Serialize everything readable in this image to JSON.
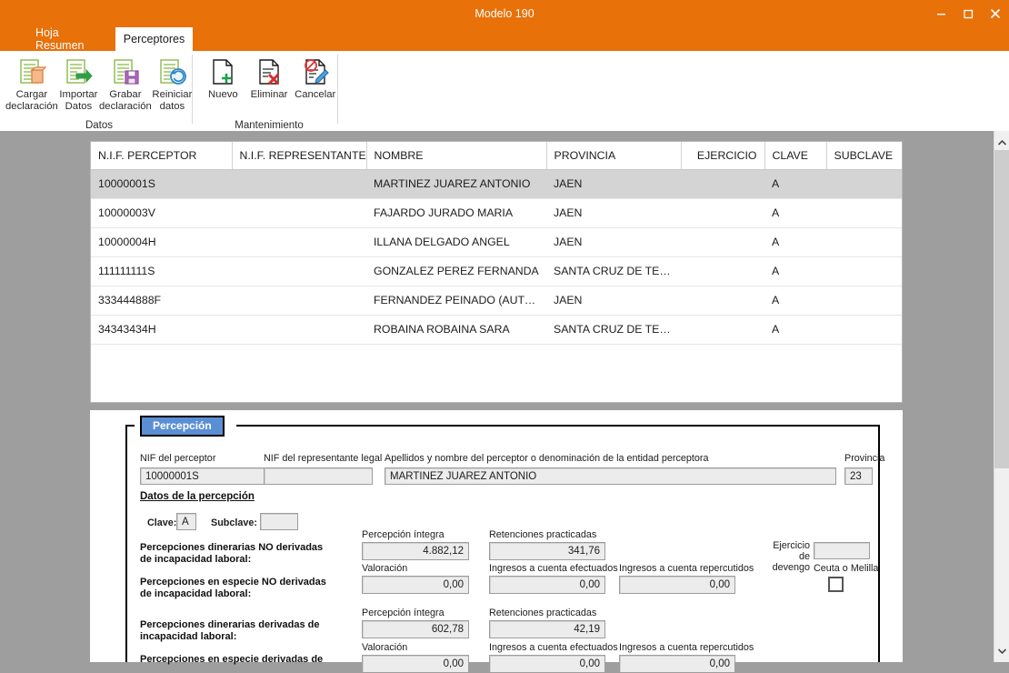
{
  "window": {
    "title": "Modelo 190",
    "accent_color": "#e8710a",
    "controls": [
      {
        "name": "minimize",
        "glyph": "—"
      },
      {
        "name": "maximize",
        "glyph": "☐"
      },
      {
        "name": "close",
        "glyph": "✕"
      }
    ]
  },
  "tabs": [
    {
      "id": "hoja-resumen",
      "label": "Hoja Resumen",
      "active": false
    },
    {
      "id": "perceptores",
      "label": "Perceptores",
      "active": true
    }
  ],
  "ribbon": {
    "groups": [
      {
        "id": "datos",
        "label": "Datos",
        "buttons": [
          {
            "id": "cargar-declaracion",
            "label": "Cargar\ndeclaración",
            "icon": "document-load-icon"
          },
          {
            "id": "importar-datos",
            "label": "Importar\nDatos",
            "icon": "document-import-arrow-icon"
          },
          {
            "id": "grabar-declaracion",
            "label": "Grabar\ndeclaración",
            "icon": "document-save-floppy-icon"
          },
          {
            "id": "reiniciar-datos",
            "label": "Reiniciar\ndatos",
            "icon": "document-refresh-icon"
          }
        ]
      },
      {
        "id": "mantenimiento",
        "label": "Mantenimiento",
        "buttons": [
          {
            "id": "nuevo",
            "label": "Nuevo",
            "icon": "document-plus-icon"
          },
          {
            "id": "eliminar",
            "label": "Eliminar",
            "icon": "document-delete-x-icon"
          },
          {
            "id": "cancelar",
            "label": "Cancelar",
            "icon": "document-cancel-pencil-icon"
          }
        ]
      }
    ]
  },
  "grid": {
    "columns": [
      {
        "key": "nif",
        "label": "N.I.F. PERCEPTOR",
        "align": "left"
      },
      {
        "key": "representante",
        "label": "N.I.F. REPRESENTANTE",
        "align": "left"
      },
      {
        "key": "nombre",
        "label": "NOMBRE",
        "align": "left"
      },
      {
        "key": "provincia",
        "label": "PROVINCIA",
        "align": "left"
      },
      {
        "key": "ejercicio",
        "label": "EJERCICIO",
        "align": "right"
      },
      {
        "key": "clave",
        "label": "CLAVE",
        "align": "left"
      },
      {
        "key": "subclave",
        "label": "SUBCLAVE",
        "align": "left"
      }
    ],
    "rows": [
      {
        "nif": "10000001S",
        "representante": "",
        "nombre": "MARTINEZ JUAREZ ANTONIO",
        "provincia": "JAEN",
        "ejercicio": "",
        "clave": "A",
        "subclave": "",
        "selected": true
      },
      {
        "nif": "10000003V",
        "representante": "",
        "nombre": "FAJARDO JURADO MARIA",
        "provincia": "JAEN",
        "ejercicio": "",
        "clave": "A",
        "subclave": "",
        "selected": false
      },
      {
        "nif": "10000004H",
        "representante": "",
        "nombre": "ILLANA DELGADO ANGEL",
        "provincia": "JAEN",
        "ejercicio": "",
        "clave": "A",
        "subclave": "",
        "selected": false
      },
      {
        "nif": "111111111S",
        "representante": "",
        "nombre": "GONZALEZ PEREZ FERNANDA",
        "provincia": "SANTA CRUZ DE TENERIFE",
        "ejercicio": "",
        "clave": "A",
        "subclave": "",
        "selected": false
      },
      {
        "nif": "333444888F",
        "representante": "",
        "nombre": "FERNANDEZ PEINADO (AUTONO...",
        "provincia": "JAEN",
        "ejercicio": "",
        "clave": "A",
        "subclave": "",
        "selected": false
      },
      {
        "nif": "34343434H",
        "representante": "",
        "nombre": "ROBAINA ROBAINA SARA",
        "provincia": "SANTA CRUZ DE TENERIFE",
        "ejercicio": "",
        "clave": "A",
        "subclave": "",
        "selected": false
      }
    ]
  },
  "detail": {
    "caption": "Percepción",
    "caption_bg": "#5b8fd4",
    "nif_perceptor": {
      "label": "NIF del perceptor",
      "value": "10000001S"
    },
    "nif_representante": {
      "label": "NIF del representante legal",
      "value": ""
    },
    "apellidos": {
      "label": "Apellidos y nombre del perceptor o denominación de la entidad perceptora",
      "value": "MARTINEZ JUAREZ ANTONIO"
    },
    "provincia": {
      "label": "Provincia",
      "value": "23"
    },
    "section_title": "Datos de la percepción",
    "clave": {
      "label": "Clave:",
      "value": "A"
    },
    "subclave": {
      "label": "Subclave:",
      "value": ""
    },
    "ejercicio_devengo": {
      "label": "Ejercicio de\ndevengo",
      "value": ""
    },
    "ceuta_melilla": {
      "label": "Ceuta o Melilla",
      "checked": false
    },
    "blocks": [
      {
        "id": "dinerarias-no-incapacidad",
        "row_label": "Percepciones dinerarias NO derivadas de incapacidad laboral:",
        "fields": [
          {
            "label": "Percepción íntegra",
            "value": "4.882,12"
          },
          {
            "label": "Retenciones practicadas",
            "value": "341,76"
          }
        ]
      },
      {
        "id": "especie-no-incapacidad",
        "row_label": "Percepciones en especie NO derivadas de incapacidad laboral:",
        "fields": [
          {
            "label": "Valoración",
            "value": "0,00"
          },
          {
            "label": "Ingresos a cuenta efectuados",
            "value": "0,00"
          },
          {
            "label": "Ingresos a cuenta repercutidos",
            "value": "0,00"
          }
        ]
      },
      {
        "id": "dinerarias-incapacidad",
        "row_label": "Percepciones dinerarias derivadas de incapacidad laboral:",
        "fields": [
          {
            "label": "Percepción íntegra",
            "value": "602,78"
          },
          {
            "label": "Retenciones practicadas",
            "value": "42,19"
          }
        ]
      },
      {
        "id": "especie-incapacidad",
        "row_label": "Percepciones en especie derivadas de",
        "fields": [
          {
            "label": "Valoración",
            "value": "0,00"
          },
          {
            "label": "Ingresos a cuenta efectuados",
            "value": "0,00"
          },
          {
            "label": "Ingresos a cuenta repercutidos",
            "value": "0,00"
          }
        ]
      }
    ]
  },
  "scrollbar": {
    "up_glyph": "▲",
    "down_glyph": "▼"
  }
}
